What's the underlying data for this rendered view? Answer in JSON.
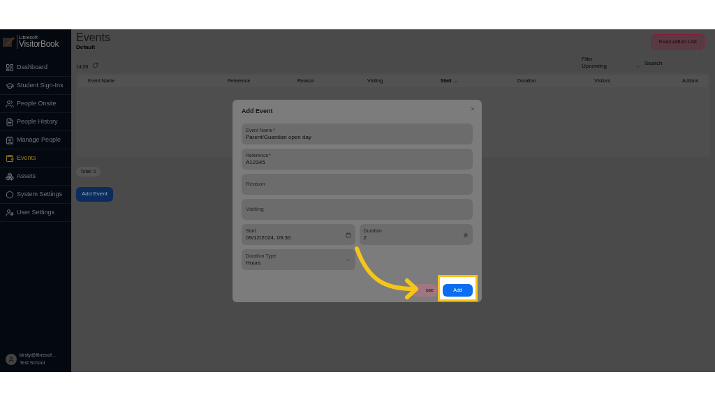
{
  "brand": {
    "maker": "Libresoft",
    "name": "VisitorBook"
  },
  "sidebar": {
    "items": [
      {
        "label": "Dashboard",
        "selected": false
      },
      {
        "label": "Student Sign-Ins",
        "selected": false
      },
      {
        "label": "People Onsite",
        "selected": false
      },
      {
        "label": "People History",
        "selected": false
      },
      {
        "label": "Manage People",
        "selected": false
      },
      {
        "label": "Events",
        "selected": true
      },
      {
        "label": "Assets",
        "selected": false
      },
      {
        "label": "System Settings",
        "selected": false
      },
      {
        "label": "User Settings",
        "selected": false
      }
    ],
    "user": {
      "email": "kirsty@libresof...",
      "organisation": "Test School"
    }
  },
  "page": {
    "title": "Events",
    "subtitle": "Default",
    "time": "14:59",
    "evacuation_button": "Evacuation List",
    "filter": {
      "label": "Filter",
      "value": "Upcoming"
    },
    "search": {
      "placeholder": "Search"
    },
    "table": {
      "columns": [
        {
          "label": "Event Name",
          "sorted": false
        },
        {
          "label": "Reference",
          "sorted": false
        },
        {
          "label": "Reason",
          "sorted": false
        },
        {
          "label": "Visiting",
          "sorted": false
        },
        {
          "label": "Start",
          "sorted": true
        },
        {
          "label": "Duration",
          "sorted": false
        },
        {
          "label": "Visitors",
          "sorted": false
        },
        {
          "label": "Actions",
          "sorted": false
        }
      ]
    },
    "total": "Total: 0",
    "add_button": "Add Event"
  },
  "dialog": {
    "title": "Add Event",
    "fields": [
      {
        "kind": "text",
        "label": "Event Name",
        "required": true,
        "value": "Parent/Guardian open day"
      },
      {
        "kind": "text",
        "label": "Reference",
        "required": true,
        "value": "A12345"
      },
      {
        "kind": "text",
        "label": "Reason",
        "required": false
      },
      {
        "kind": "text",
        "label": "Visiting",
        "required": false
      },
      {
        "kind": "date",
        "label": "Start",
        "required": false,
        "value": "09/12/2024, 09:30"
      },
      {
        "kind": "number",
        "label": "Duration",
        "required": false,
        "value": "2"
      },
      {
        "kind": "select",
        "label": "Duration Type",
        "required": false,
        "value": "Hours"
      }
    ],
    "required_mark": "*",
    "buttons": [
      {
        "kind": "secondary",
        "label": "ose",
        "highlighted": false
      },
      {
        "kind": "primary",
        "label": "Add",
        "highlighted": true
      }
    ]
  }
}
